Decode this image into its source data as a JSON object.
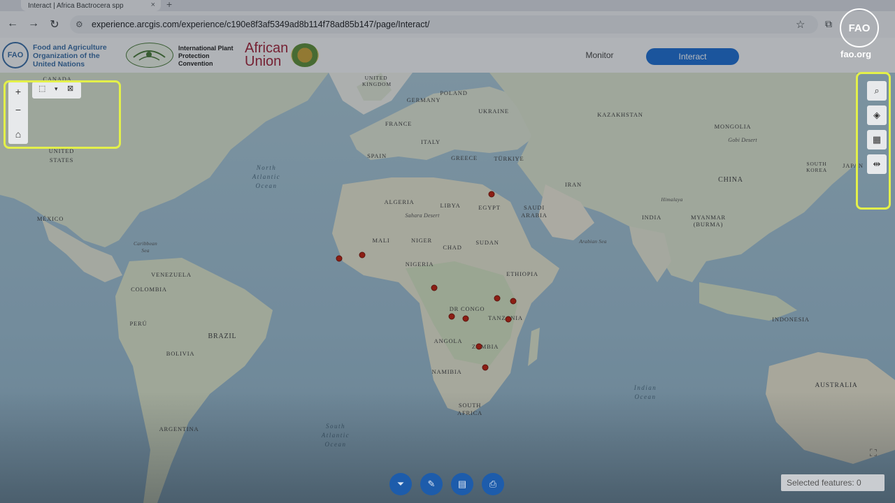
{
  "browser": {
    "tab_title": "Interact | Africa Bactrocera spp",
    "tab_close": "×",
    "new_tab": "+",
    "url": "experience.arcgis.com/experience/c190e8f3af5349ad8b114f78ad85b147/page/Interact/",
    "nav": {
      "back": "←",
      "forward": "→",
      "reload": "↻"
    }
  },
  "header": {
    "fao_name": "Food and Agriculture Organization of the United Nations",
    "fao_mark": "FAO",
    "ippc_name": "International Plant Protection Convention",
    "au_name": "African Union",
    "nav": [
      {
        "label": "Monitor",
        "active": false
      },
      {
        "label": "Interact",
        "active": true
      }
    ],
    "accent": "#1f6fd1"
  },
  "watermark": {
    "mark": "FAO",
    "site": "fao.org"
  },
  "map": {
    "labels": [
      {
        "text": "CANADA",
        "type": "country"
      },
      {
        "text": "UNITED STATES",
        "type": "country"
      },
      {
        "text": "MÉXICO",
        "type": "country"
      },
      {
        "text": "VENEZUELA",
        "type": "country"
      },
      {
        "text": "COLOMBIA",
        "type": "country"
      },
      {
        "text": "PERÚ",
        "type": "country"
      },
      {
        "text": "BRAZIL",
        "type": "country"
      },
      {
        "text": "BOLIVIA",
        "type": "country"
      },
      {
        "text": "ARGENTINA",
        "type": "country"
      },
      {
        "text": "UNITED KINGDOM",
        "type": "country"
      },
      {
        "text": "FRANCE",
        "type": "country"
      },
      {
        "text": "SPAIN",
        "type": "country"
      },
      {
        "text": "GERMANY",
        "type": "country"
      },
      {
        "text": "POLAND",
        "type": "country"
      },
      {
        "text": "UKRAINE",
        "type": "country"
      },
      {
        "text": "ITALY",
        "type": "country"
      },
      {
        "text": "GREECE",
        "type": "country"
      },
      {
        "text": "TÜRKIYE",
        "type": "country"
      },
      {
        "text": "KAZAKHSTAN",
        "type": "country"
      },
      {
        "text": "MONGOLIA",
        "type": "country"
      },
      {
        "text": "CHINA",
        "type": "country"
      },
      {
        "text": "IRAN",
        "type": "country"
      },
      {
        "text": "INDIA",
        "type": "country"
      },
      {
        "text": "MYANMAR (BURMA)",
        "type": "country"
      },
      {
        "text": "SOUTH KOREA",
        "type": "country"
      },
      {
        "text": "JAPAN",
        "type": "country"
      },
      {
        "text": "INDONESIA",
        "type": "country"
      },
      {
        "text": "AUSTRALIA",
        "type": "country"
      },
      {
        "text": "ALGERIA",
        "type": "country"
      },
      {
        "text": "LIBYA",
        "type": "country"
      },
      {
        "text": "EGYPT",
        "type": "country"
      },
      {
        "text": "SAUDI ARABIA",
        "type": "country"
      },
      {
        "text": "MALI",
        "type": "country"
      },
      {
        "text": "NIGER",
        "type": "country"
      },
      {
        "text": "CHAD",
        "type": "country"
      },
      {
        "text": "SUDAN",
        "type": "country"
      },
      {
        "text": "NIGERIA",
        "type": "country"
      },
      {
        "text": "ETHIOPIA",
        "type": "country"
      },
      {
        "text": "DR CONGO",
        "type": "country"
      },
      {
        "text": "TANZANIA",
        "type": "country"
      },
      {
        "text": "ANGOLA",
        "type": "country"
      },
      {
        "text": "ZAMBIA",
        "type": "country"
      },
      {
        "text": "NAMIBIA",
        "type": "country"
      },
      {
        "text": "SOUTH AFRICA",
        "type": "country"
      },
      {
        "text": "North Atlantic Ocean",
        "type": "ocean"
      },
      {
        "text": "South Atlantic Ocean",
        "type": "ocean"
      },
      {
        "text": "Indian Ocean",
        "type": "ocean"
      },
      {
        "text": "Caribbean Sea",
        "type": "small"
      },
      {
        "text": "Arabian Sea",
        "type": "small"
      },
      {
        "text": "Sahara Desert",
        "type": "small"
      },
      {
        "text": "Gobi Desert",
        "type": "small"
      },
      {
        "text": "Himalaya",
        "type": "small"
      }
    ],
    "marker_color": "#c0200e"
  },
  "left_controls": {
    "zoom_in": "+",
    "zoom_out": "−",
    "home": "⌂",
    "select": "⬚",
    "select_caret": "▾",
    "clear_selection": "⊠"
  },
  "right_controls": {
    "search": "⌕",
    "layers": "◈",
    "basemap": "▦",
    "measure": "⇹"
  },
  "bottom_toolbar": {
    "filter": "⏷",
    "edit": "✎",
    "table": "▤",
    "print": "⎙",
    "selected_features": "Selected features: 0",
    "fullscreen": "⛶"
  }
}
